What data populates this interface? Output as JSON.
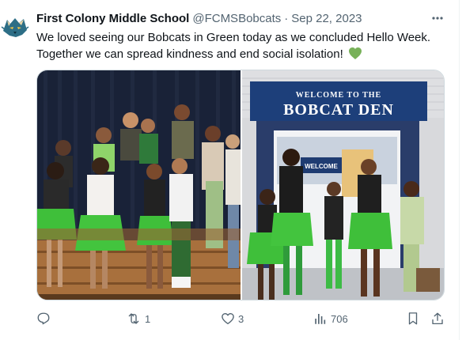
{
  "tweet": {
    "display_name": "First Colony Middle School",
    "handle": "@FCMSBobcats",
    "separator": "·",
    "date": "Sep 22, 2023",
    "text_line1": "We loved seeing our Bobcats in Green today as we concluded Hello Week.",
    "text_line2": "Together we can spread kindness and end social isolation!",
    "emoji": "green-heart"
  },
  "media": {
    "right_sign_line1": "WELCOME TO THE",
    "right_sign_line2": "BOBCAT DEN",
    "hallway_sign": "WELCOME"
  },
  "actions": {
    "reply_count": "",
    "retweet_count": "1",
    "like_count": "3",
    "views_count": "706"
  },
  "colors": {
    "muted": "#536471",
    "text": "#0f1419",
    "border": "#cfd9de",
    "tutu_green": "#3fbf3a",
    "heart_green": "#78b159",
    "sign_blue": "#1d3f7a"
  }
}
